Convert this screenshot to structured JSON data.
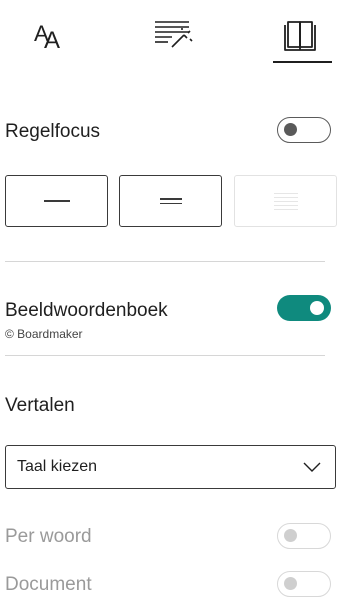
{
  "tabs": [
    {
      "name": "text-size",
      "icon": "text-size-icon"
    },
    {
      "name": "grammar",
      "icon": "grammar-options-icon"
    },
    {
      "name": "reading",
      "icon": "reading-preferences-icon",
      "selected": true
    }
  ],
  "line_focus": {
    "title": "Regelfocus",
    "enabled": false,
    "options": [
      {
        "name": "one-line",
        "lines": 1,
        "disabled": false
      },
      {
        "name": "three-lines",
        "lines": 3,
        "disabled": false
      },
      {
        "name": "five-lines",
        "lines": 5,
        "disabled": true
      }
    ]
  },
  "picture_dictionary": {
    "title": "Beeldwoordenboek",
    "credit": "© Boardmaker",
    "enabled": true
  },
  "translate": {
    "title": "Vertalen",
    "select_value": "Taal kiezen",
    "per_word_label": "Per woord",
    "per_word_enabled": false,
    "document_label": "Document",
    "document_enabled": false
  },
  "colors": {
    "accent": "#0f8a7e",
    "text": "#1f1f1f",
    "muted": "#9a9a9a",
    "divider": "#d6d6d6"
  }
}
